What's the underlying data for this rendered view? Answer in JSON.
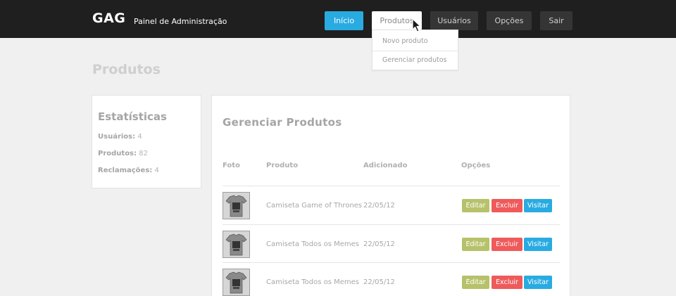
{
  "header": {
    "logo": "GAG",
    "subtitle": "Painel de Administração",
    "nav": {
      "inicio": "Início",
      "produtos": "Produtos",
      "usuarios": "Usuários",
      "opcoes": "Opções",
      "sair": "Sair"
    },
    "dropdown": [
      "Novo produto",
      "Gerenciar produtos"
    ]
  },
  "page_title": "Produtos",
  "stats": {
    "title": "Estatísticas",
    "rows": [
      {
        "label": "Usuários:",
        "value": "4"
      },
      {
        "label": "Produtos:",
        "value": "82"
      },
      {
        "label": "Reclamações:",
        "value": "4"
      }
    ]
  },
  "main": {
    "title": "Gerenciar Produtos",
    "columns": [
      "Foto",
      "Produto",
      "Adicionado",
      "Opções"
    ],
    "rows": [
      {
        "produto": "Camiseta Game of Thrones",
        "adicionado": "22/05/12"
      },
      {
        "produto": "Camiseta Todos os Memes",
        "adicionado": "22/05/12"
      },
      {
        "produto": "Camiseta Todos os Memes",
        "adicionado": "22/05/12"
      }
    ],
    "actions": {
      "edit": "Editar",
      "delete": "Excluir",
      "visit": "Visitar"
    }
  },
  "colors": {
    "accent": "#29abe2",
    "edit": "#b7c16a",
    "delete": "#ef5a5a",
    "topbar": "#1f1f1f"
  },
  "icons": {
    "cursor": "mouse-pointer-icon",
    "thumbnail": "tshirt-thumbnail-icon"
  }
}
